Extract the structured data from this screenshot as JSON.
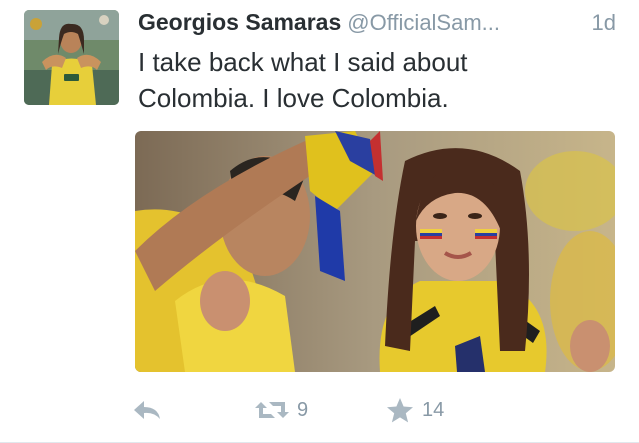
{
  "tweet": {
    "display_name": "Georgios Samaras",
    "handle": "@OfficialSam",
    "handle_ellipsis": "...",
    "timestamp": "1d",
    "text_line1": "I take back what I said about",
    "text_line2": "Colombia. I love Colombia.",
    "avatar_icon": "user-avatar-photo",
    "media_icon": "photo-colombia-fan"
  },
  "actions": {
    "reply_icon": "reply-icon",
    "retweet_icon": "retweet-icon",
    "retweet_count": "9",
    "favorite_icon": "star-icon",
    "favorite_count": "14"
  },
  "colors": {
    "name": "#292f33",
    "secondary": "#8899a6",
    "action_icon": "#aab8c2"
  }
}
